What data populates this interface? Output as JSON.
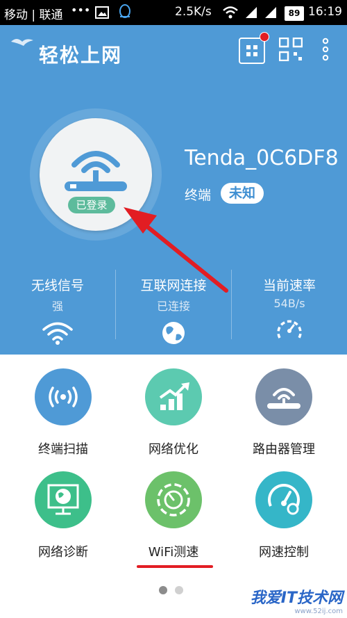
{
  "status_bar": {
    "carrier": "移动 | 联通",
    "dots": "•••",
    "speed": "2.5K/s",
    "battery": "89",
    "time": "16:19"
  },
  "app_bar": {
    "title": "轻松上网",
    "icons": [
      "grid-menu-icon",
      "qr-code-icon",
      "more-vert-icon"
    ],
    "notification_dot_color": "#e21d23"
  },
  "router": {
    "login_badge": "已登录",
    "ssid": "Tenda_0C6DF8",
    "terminal_label": "终端",
    "terminal_value": "未知"
  },
  "stats": [
    {
      "title": "无线信号",
      "value": "强",
      "icon": "wifi-signal-icon"
    },
    {
      "title": "互联网连接",
      "value": "已连接",
      "icon": "globe-icon"
    },
    {
      "title": "当前速率",
      "value": "54B/s",
      "icon": "speedometer-icon"
    }
  ],
  "tiles": [
    {
      "label": "终端扫描",
      "icon": "radar-scan-icon",
      "color": "#4f9ad6"
    },
    {
      "label": "网络优化",
      "icon": "optimize-chart-icon",
      "color": "#5ccab0"
    },
    {
      "label": "路由器管理",
      "icon": "router-manage-icon",
      "color": "#7a8ea8"
    },
    {
      "label": "网络诊断",
      "icon": "diagnosis-monitor-icon",
      "color": "#3dbf8a"
    },
    {
      "label": "WiFi测速",
      "icon": "speed-test-icon",
      "color": "#6cc16a"
    },
    {
      "label": "网速控制",
      "icon": "speed-control-icon",
      "color": "#35b6c8"
    }
  ],
  "watermark": {
    "title": "我爱IT技术网",
    "url": "www.52ij.com"
  },
  "colors": {
    "primary": "#4f9ad6",
    "accent_red": "#e21d23",
    "login_green": "#5dbb9c"
  }
}
